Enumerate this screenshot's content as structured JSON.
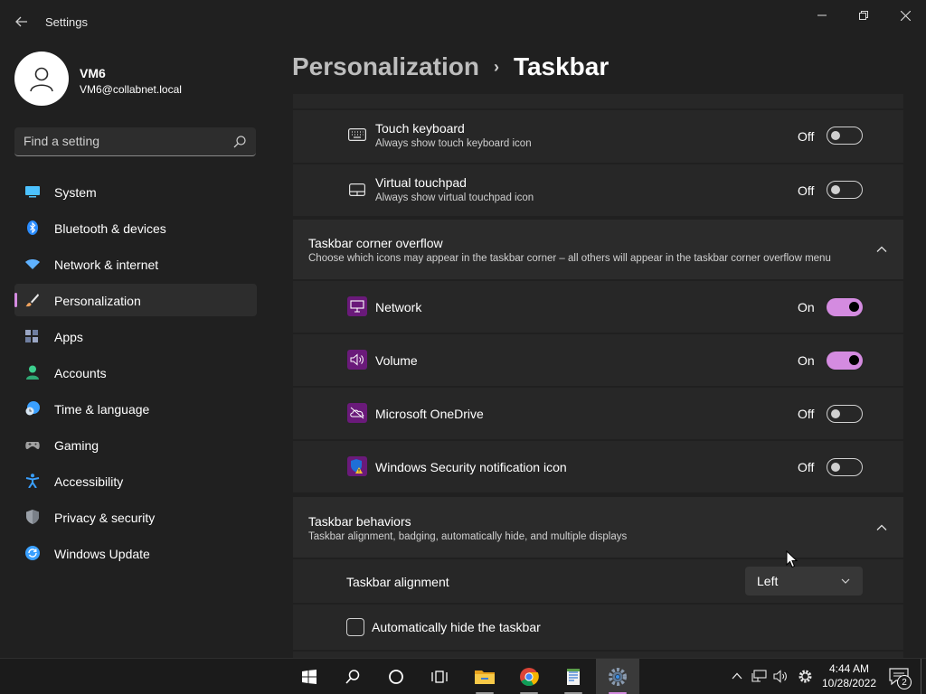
{
  "window": {
    "title": "Settings"
  },
  "user": {
    "name": "VM6",
    "email": "VM6@collabnet.local"
  },
  "search": {
    "placeholder": "Find a setting"
  },
  "sidebar": {
    "items": [
      {
        "label": "System",
        "icon": "system-icon",
        "color": "#4cc2ff"
      },
      {
        "label": "Bluetooth & devices",
        "icon": "bluetooth-icon",
        "color": "#2a8cff"
      },
      {
        "label": "Network & internet",
        "icon": "wifi-icon",
        "color": "#5fb2ff"
      },
      {
        "label": "Personalization",
        "icon": "brush-icon",
        "color": "#f0a35e"
      },
      {
        "label": "Apps",
        "icon": "apps-icon",
        "color": "#9aa6c4"
      },
      {
        "label": "Accounts",
        "icon": "accounts-icon",
        "color": "#3ccf8e"
      },
      {
        "label": "Time & language",
        "icon": "clock-globe-icon",
        "color": "#3aa0ff"
      },
      {
        "label": "Gaming",
        "icon": "gamepad-icon",
        "color": "#a0a0a0"
      },
      {
        "label": "Accessibility",
        "icon": "accessibility-icon",
        "color": "#3aa0ff"
      },
      {
        "label": "Privacy & security",
        "icon": "shield-icon",
        "color": "#9aa0a8"
      },
      {
        "label": "Windows Update",
        "icon": "update-icon",
        "color": "#3aa0ff"
      }
    ],
    "active_index": 3
  },
  "breadcrumb": {
    "parent": "Personalization",
    "separator": "›",
    "current": "Taskbar"
  },
  "pen_section": {
    "touch_keyboard": {
      "title": "Touch keyboard",
      "desc": "Always show touch keyboard icon",
      "state": "Off",
      "icon": "keyboard-icon"
    },
    "virtual_touchpad": {
      "title": "Virtual touchpad",
      "desc": "Always show virtual touchpad icon",
      "state": "Off",
      "icon": "touchpad-icon"
    }
  },
  "corner_overflow": {
    "title": "Taskbar corner overflow",
    "desc": "Choose which icons may appear in the taskbar corner – all others will appear in the taskbar corner overflow menu",
    "items": [
      {
        "title": "Network",
        "state": "On",
        "icon": "network-icon"
      },
      {
        "title": "Volume",
        "state": "On",
        "icon": "volume-icon"
      },
      {
        "title": "Microsoft OneDrive",
        "state": "Off",
        "icon": "onedrive-icon"
      },
      {
        "title": "Windows Security notification icon",
        "state": "Off",
        "icon": "windows-security-icon"
      }
    ]
  },
  "behaviors": {
    "title": "Taskbar behaviors",
    "desc": "Taskbar alignment, badging, automatically hide, and multiple displays",
    "alignment_label": "Taskbar alignment",
    "alignment_value": "Left",
    "autohide_label": "Automatically hide the taskbar",
    "autohide_checked": false
  },
  "taskbar": {
    "apps": [
      "start-icon",
      "search-icon",
      "cortana-icon",
      "task-view-icon",
      "file-explorer-icon",
      "chrome-icon",
      "notepad-app-icon",
      "settings-app-icon"
    ],
    "time": "4:44 AM",
    "date": "10/28/2022",
    "notification_count": "2"
  },
  "colors": {
    "accent": "#d48be0",
    "background": "#202020",
    "card": "#2b2b2b"
  }
}
